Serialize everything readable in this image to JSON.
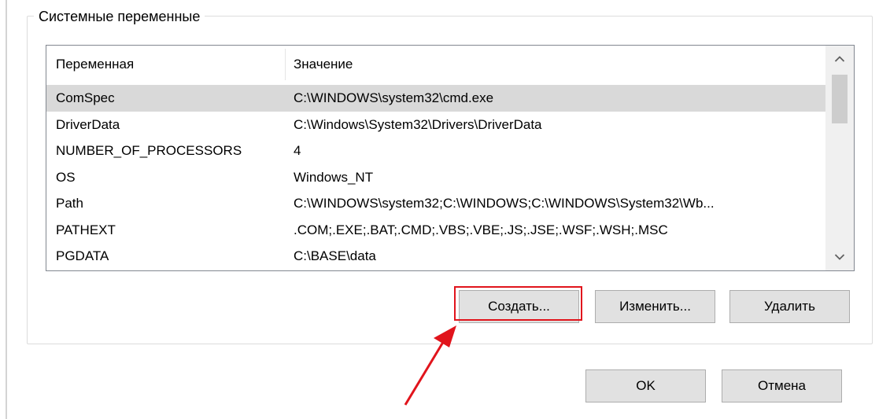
{
  "group": {
    "title": "Системные переменные"
  },
  "columns": {
    "name": "Переменная",
    "value": "Значение"
  },
  "rows": [
    {
      "name": "ComSpec",
      "value": "C:\\WINDOWS\\system32\\cmd.exe",
      "selected": true
    },
    {
      "name": "DriverData",
      "value": "C:\\Windows\\System32\\Drivers\\DriverData"
    },
    {
      "name": "NUMBER_OF_PROCESSORS",
      "value": "4"
    },
    {
      "name": "OS",
      "value": "Windows_NT"
    },
    {
      "name": "Path",
      "value": "C:\\WINDOWS\\system32;C:\\WINDOWS;C:\\WINDOWS\\System32\\Wb..."
    },
    {
      "name": "PATHEXT",
      "value": ".COM;.EXE;.BAT;.CMD;.VBS;.VBE;.JS;.JSE;.WSF;.WSH;.MSC"
    },
    {
      "name": "PGDATA",
      "value": "C:\\BASE\\data"
    }
  ],
  "buttons": {
    "create": "Создать...",
    "edit": "Изменить...",
    "delete": "Удалить",
    "ok": "OK",
    "cancel": "Отмена"
  },
  "icons": {
    "scroll_up": "chevron-up-icon",
    "scroll_down": "chevron-down-icon"
  },
  "colors": {
    "highlight": "#e1141c",
    "selected_row": "#d9d9d9"
  }
}
